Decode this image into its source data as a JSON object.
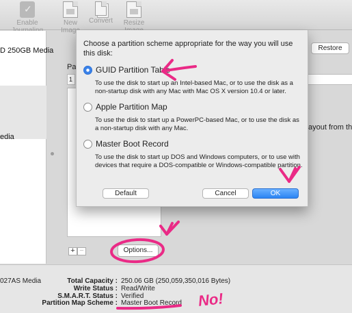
{
  "toolbar": {
    "items": [
      {
        "label": "Enable Journaling",
        "icon": "journaling-icon"
      },
      {
        "label": "New Image",
        "icon": "new-image-icon"
      },
      {
        "label": "Convert",
        "icon": "convert-icon"
      },
      {
        "label": "Resize Image",
        "icon": "resize-image-icon"
      }
    ]
  },
  "sidebar": {
    "items": [
      {
        "label": "D 250GB Media"
      },
      {
        "label": "edia"
      }
    ]
  },
  "main": {
    "restore_label": "Restore",
    "partition_label": "Pa",
    "field_value": "1",
    "layout_text": "ayout from the Pa",
    "options_label": "Options...",
    "add_label": "+",
    "remove_label": "−"
  },
  "info": {
    "left_text": "027AS Media",
    "rows": [
      {
        "label": "Total Capacity :",
        "value": "250.06 GB (250,059,350,016 Bytes)"
      },
      {
        "label": "Write Status :",
        "value": "Read/Write"
      },
      {
        "label": "S.M.A.R.T. Status :",
        "value": "Verified"
      },
      {
        "label": "Partition Map Scheme :",
        "value": "Master Boot Record"
      }
    ]
  },
  "dialog": {
    "title": "Choose a partition scheme appropriate for the way you will use this disk:",
    "options": [
      {
        "label": "GUID Partition Table",
        "desc": "To use the disk to start up an Intel-based Mac, or to use the disk as a non-startup disk with any Mac with Mac OS X version 10.4 or later.",
        "checked": true
      },
      {
        "label": "Apple Partition Map",
        "desc": "To use the disk to start up a PowerPC-based Mac, or to use the disk as a non-startup disk with any Mac.",
        "checked": false
      },
      {
        "label": "Master Boot Record",
        "desc": "To use the disk to start up DOS and Windows computers, or to use with devices that require a DOS-compatible or Windows-compatible partition.",
        "checked": false
      }
    ],
    "default_label": "Default",
    "cancel_label": "Cancel",
    "ok_label": "OK"
  },
  "annotation": {
    "no_text": "No!",
    "color": "#ea2a86"
  }
}
